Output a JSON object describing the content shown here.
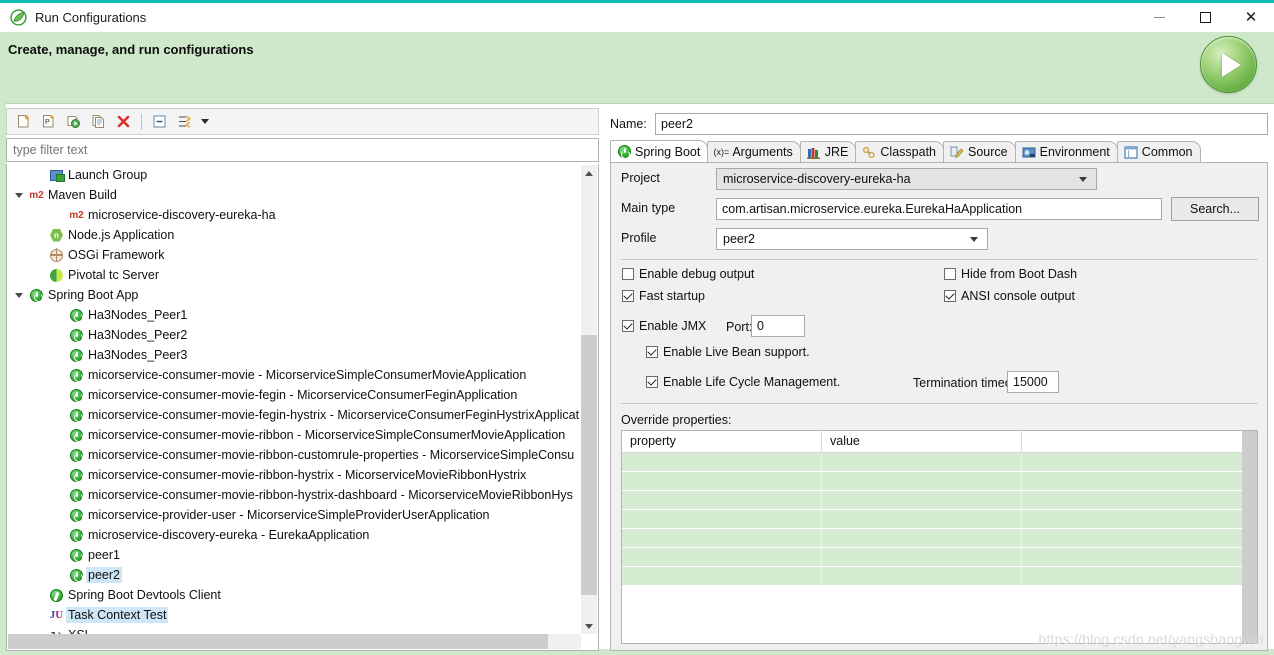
{
  "window": {
    "title": "Run Configurations",
    "app_icon": "spring-leaf-icon",
    "minimize": "–",
    "maximize": "□",
    "close": "✕"
  },
  "banner": {
    "title": "Create, manage, and run configurations",
    "run_button": "run-button",
    "accent_color": "#0fbcb6",
    "background_color": "#cfe8cb"
  },
  "left_panel": {
    "toolbar": [
      {
        "name": "new-configuration-icon",
        "tooltip": "New launch configuration"
      },
      {
        "name": "new-prototype-icon",
        "tooltip": "New prototype"
      },
      {
        "name": "export-configuration-icon",
        "tooltip": "Export"
      },
      {
        "name": "duplicate-configuration-icon",
        "tooltip": "Duplicate"
      },
      {
        "name": "delete-configuration-icon",
        "tooltip": "Delete"
      },
      {
        "name": "collapse-all-icon",
        "tooltip": "Collapse All"
      },
      {
        "name": "filter-launch-configurations-icon",
        "tooltip": "Filter"
      },
      {
        "name": "chevron-down-icon",
        "tooltip": "View menu"
      }
    ],
    "filter": {
      "value": "",
      "placeholder": "type filter text"
    },
    "tree": [
      {
        "label": "Launch Group",
        "icon": "launch-group-icon",
        "indent": 1,
        "twisty": "none",
        "selected": false
      },
      {
        "label": "Maven Build",
        "icon": "maven-icon",
        "indent": 0,
        "twisty": "expanded",
        "selected": false
      },
      {
        "label": "microservice-discovery-eureka-ha",
        "icon": "maven-icon",
        "indent": 2,
        "twisty": "none",
        "selected": false
      },
      {
        "label": "Node.js Application",
        "icon": "nodejs-icon",
        "indent": 1,
        "twisty": "none",
        "selected": false
      },
      {
        "label": "OSGi Framework",
        "icon": "osgi-icon",
        "indent": 1,
        "twisty": "none",
        "selected": false
      },
      {
        "label": "Pivotal tc Server",
        "icon": "pivotal-icon",
        "indent": 1,
        "twisty": "none",
        "selected": false
      },
      {
        "label": "Spring Boot App",
        "icon": "spring-boot-icon",
        "indent": 0,
        "twisty": "expanded",
        "selected": false
      },
      {
        "label": "Ha3Nodes_Peer1",
        "icon": "spring-boot-icon",
        "indent": 2,
        "twisty": "none",
        "selected": false
      },
      {
        "label": "Ha3Nodes_Peer2",
        "icon": "spring-boot-icon",
        "indent": 2,
        "twisty": "none",
        "selected": false
      },
      {
        "label": "Ha3Nodes_Peer3",
        "icon": "spring-boot-icon",
        "indent": 2,
        "twisty": "none",
        "selected": false
      },
      {
        "label": "micorservice-consumer-movie - MicorserviceSimpleConsumerMovieApplication",
        "icon": "spring-boot-icon",
        "indent": 2,
        "twisty": "none",
        "selected": false
      },
      {
        "label": "micorservice-consumer-movie-fegin - MicorserviceConsumerFeginApplication",
        "icon": "spring-boot-icon",
        "indent": 2,
        "twisty": "none",
        "selected": false
      },
      {
        "label": "micorservice-consumer-movie-fegin-hystrix - MicorserviceConsumerFeginHystrixApplicat",
        "icon": "spring-boot-icon",
        "indent": 2,
        "twisty": "none",
        "selected": false
      },
      {
        "label": "micorservice-consumer-movie-ribbon - MicorserviceSimpleConsumerMovieApplication",
        "icon": "spring-boot-icon",
        "indent": 2,
        "twisty": "none",
        "selected": false
      },
      {
        "label": "micorservice-consumer-movie-ribbon-customrule-properties - MicorserviceSimpleConsu",
        "icon": "spring-boot-icon",
        "indent": 2,
        "twisty": "none",
        "selected": false
      },
      {
        "label": "micorservice-consumer-movie-ribbon-hystrix - MicorserviceMovieRibbonHystrix",
        "icon": "spring-boot-icon",
        "indent": 2,
        "twisty": "none",
        "selected": false
      },
      {
        "label": "micorservice-consumer-movie-ribbon-hystrix-dashboard - MicorserviceMovieRibbonHys",
        "icon": "spring-boot-icon",
        "indent": 2,
        "twisty": "none",
        "selected": false
      },
      {
        "label": "micorservice-provider-user - MicorserviceSimpleProviderUserApplication",
        "icon": "spring-boot-icon",
        "indent": 2,
        "twisty": "none",
        "selected": false
      },
      {
        "label": "microservice-discovery-eureka - EurekaApplication",
        "icon": "spring-boot-icon",
        "indent": 2,
        "twisty": "none",
        "selected": false
      },
      {
        "label": "peer1",
        "icon": "spring-boot-icon",
        "indent": 2,
        "twisty": "none",
        "selected": false
      },
      {
        "label": "peer2",
        "icon": "spring-boot-icon",
        "indent": 2,
        "twisty": "none",
        "selected": true
      },
      {
        "label": "Spring Boot Devtools Client",
        "icon": "devtools-icon",
        "indent": 1,
        "twisty": "none",
        "selected": false
      },
      {
        "label": "Task Context Test",
        "icon": "junit-icon",
        "indent": 1,
        "twisty": "none",
        "selected": true
      },
      {
        "label": "XSL",
        "icon": "xsl-icon",
        "indent": 1,
        "twisty": "none",
        "selected": false
      }
    ]
  },
  "right_panel": {
    "name_label": "Name:",
    "name_value": "peer2",
    "tabs": [
      {
        "label": "Spring Boot",
        "icon": "spring-boot-icon",
        "active": true
      },
      {
        "label": "Arguments",
        "icon": "arguments-icon",
        "active": false
      },
      {
        "label": "JRE",
        "icon": "jre-icon",
        "active": false
      },
      {
        "label": "Classpath",
        "icon": "classpath-icon",
        "active": false
      },
      {
        "label": "Source",
        "icon": "source-icon",
        "active": false
      },
      {
        "label": "Environment",
        "icon": "environment-icon",
        "active": false
      },
      {
        "label": "Common",
        "icon": "common-icon",
        "active": false
      }
    ],
    "fields": {
      "project_label": "Project",
      "project_value": "microservice-discovery-eureka-ha",
      "main_type_label": "Main type",
      "main_type_value": "com.artisan.microservice.eureka.EurekaHaApplication",
      "search_button": "Search...",
      "profile_label": "Profile",
      "profile_value": "peer2"
    },
    "options": {
      "enable_debug_output": {
        "label": "Enable debug output",
        "checked": false
      },
      "fast_startup": {
        "label": "Fast startup",
        "checked": true
      },
      "hide_from_boot_dash": {
        "label": "Hide from Boot Dash",
        "checked": false
      },
      "ansi_console_output": {
        "label": "ANSI console output",
        "checked": true
      },
      "enable_jmx": {
        "label": "Enable JMX",
        "checked": true
      },
      "port_label": "Port:",
      "port_value": "0",
      "enable_live_bean": {
        "label": "Enable Live Bean support.",
        "checked": true
      },
      "enable_life_cycle": {
        "label": "Enable Life Cycle Management.",
        "checked": true
      },
      "termination_timeout_label": "Termination timeout (ms):",
      "termination_timeout_value": "15000"
    },
    "override": {
      "label": "Override properties:",
      "columns": [
        "property",
        "value",
        ""
      ],
      "rows": [
        [
          "",
          "",
          ""
        ],
        [
          "",
          "",
          ""
        ],
        [
          "",
          "",
          ""
        ],
        [
          "",
          "",
          ""
        ],
        [
          "",
          "",
          ""
        ],
        [
          "",
          "",
          ""
        ],
        [
          "",
          "",
          ""
        ]
      ]
    }
  },
  "watermark": "https://blog.csdn.net/yangshangwei"
}
